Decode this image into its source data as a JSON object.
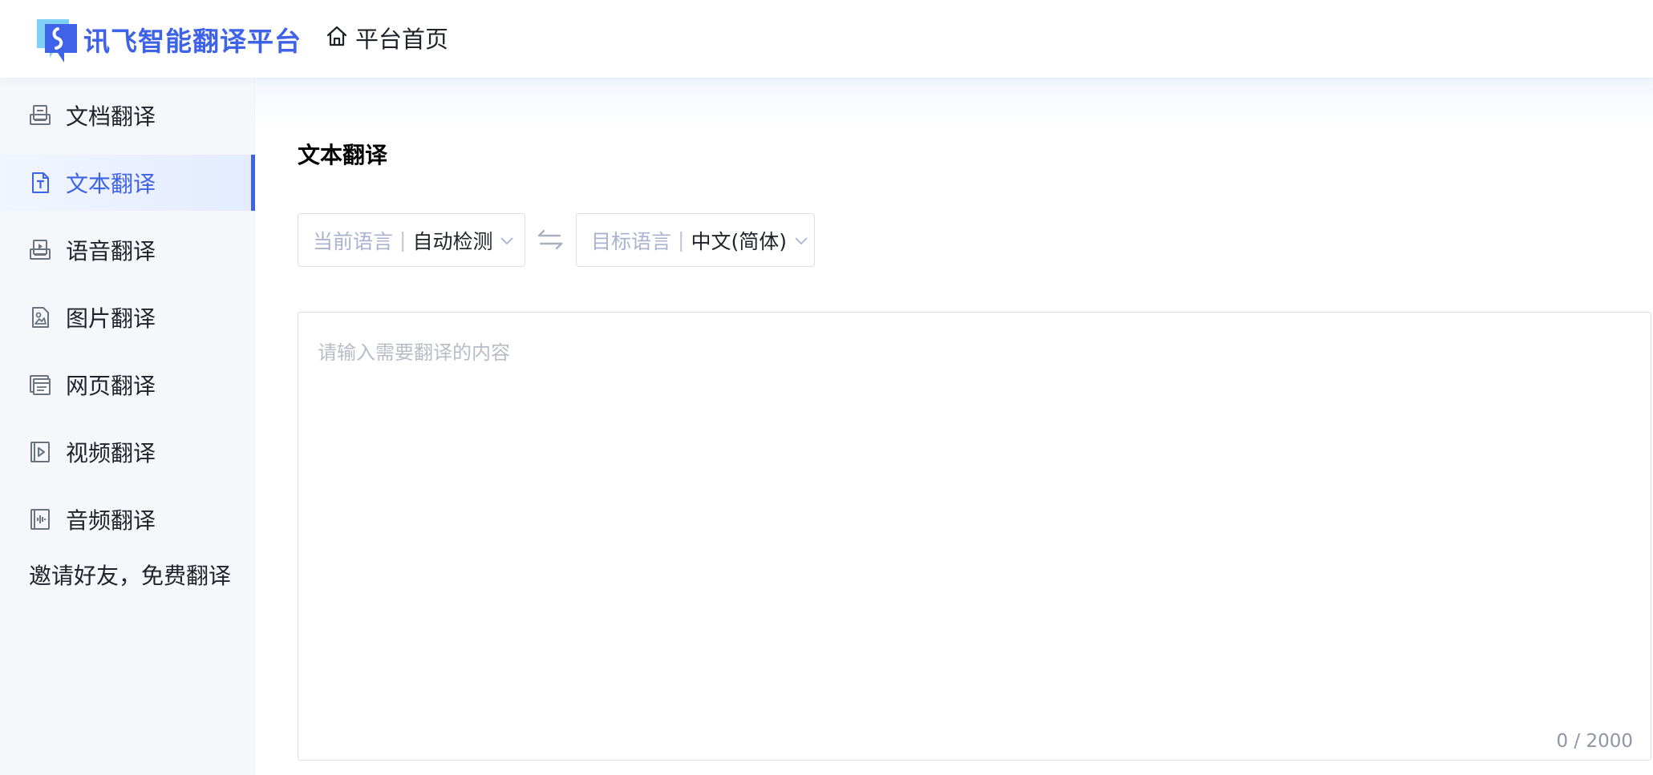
{
  "header": {
    "logo_text": "讯飞智能翻译平台",
    "home_label": "平台首页"
  },
  "sidebar": {
    "items": [
      {
        "label": "文档翻译",
        "icon": "document-icon"
      },
      {
        "label": "文本翻译",
        "icon": "text-icon",
        "active": true
      },
      {
        "label": "语音翻译",
        "icon": "voice-icon"
      },
      {
        "label": "图片翻译",
        "icon": "image-icon"
      },
      {
        "label": "网页翻译",
        "icon": "webpage-icon"
      },
      {
        "label": "视频翻译",
        "icon": "video-icon"
      },
      {
        "label": "音频翻译",
        "icon": "audio-icon"
      }
    ],
    "invite_label": "邀请好友，免费翻译"
  },
  "main": {
    "title": "文本翻译",
    "source_lang": {
      "prefix": "当前语言",
      "value": "自动检测"
    },
    "target_lang": {
      "prefix": "目标语言",
      "value": "中文(简体)"
    },
    "input": {
      "placeholder": "请输入需要翻译的内容",
      "value": "",
      "counter": "0 / 2000"
    }
  },
  "colors": {
    "accent": "#3f63e8",
    "sidebar_bg": "#f5f7fa",
    "placeholder": "#b8bcc6",
    "muted_prefix": "#a8b4cf"
  }
}
